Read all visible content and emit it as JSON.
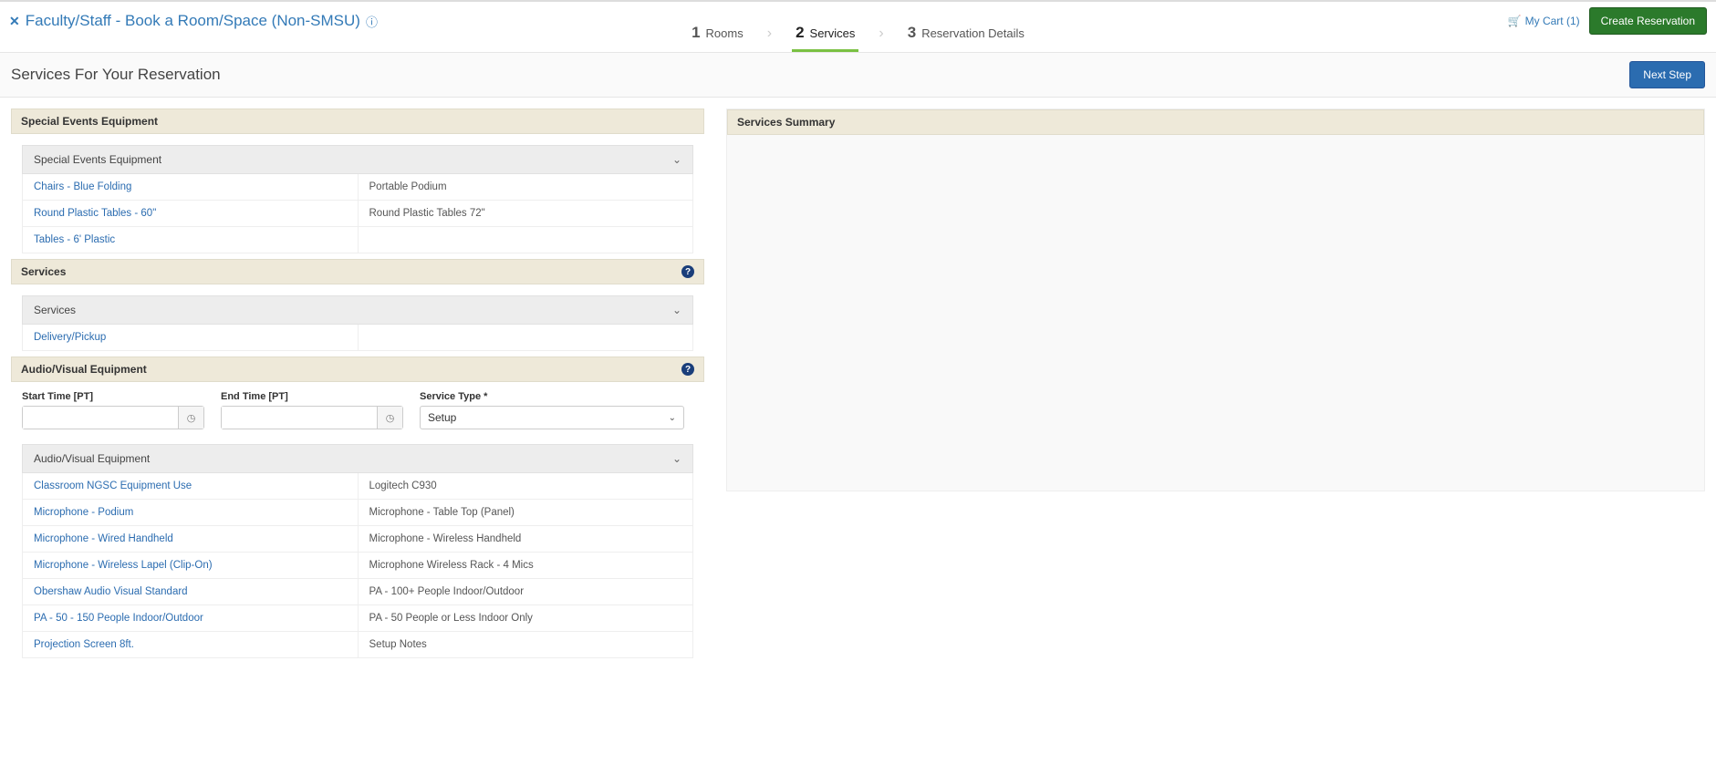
{
  "header": {
    "page_title": "Faculty/Staff - Book a Room/Space (Non-SMSU)",
    "cart_label": "My Cart (1)",
    "create_btn": "Create Reservation"
  },
  "steps": {
    "s1_num": "1",
    "s1_label": "Rooms",
    "s2_num": "2",
    "s2_label": "Services",
    "s3_num": "3",
    "s3_label": "Reservation Details"
  },
  "subheader": {
    "title": "Services For Your Reservation",
    "next_btn": "Next Step"
  },
  "sections": {
    "special_header": "Special Events Equipment",
    "special_sub": "Special Events Equipment",
    "services_header": "Services",
    "services_sub": "Services",
    "av_header": "Audio/Visual Equipment",
    "av_sub": "Audio/Visual Equipment",
    "summary_header": "Services Summary"
  },
  "special_items": {
    "r0c0": "Chairs - Blue Folding",
    "r0c1": "Portable Podium",
    "r1c0": "Round Plastic Tables - 60\"",
    "r1c1": "Round Plastic Tables 72\"",
    "r2c0": "Tables - 6' Plastic",
    "r2c1": ""
  },
  "services_items": {
    "r0c0": "Delivery/Pickup",
    "r0c1": ""
  },
  "av_form": {
    "start_label": "Start Time [PT]",
    "end_label": "End Time [PT]",
    "type_label": "Service Type *",
    "type_value": "Setup"
  },
  "av_items": {
    "r0c0": "Classroom NGSC Equipment Use",
    "r0c1": "Logitech C930",
    "r1c0": "Microphone - Podium",
    "r1c1": "Microphone - Table Top (Panel)",
    "r2c0": "Microphone - Wired Handheld",
    "r2c1": "Microphone - Wireless Handheld",
    "r3c0": "Microphone - Wireless Lapel (Clip-On)",
    "r3c1": "Microphone Wireless Rack - 4 Mics",
    "r4c0": "Obershaw Audio Visual Standard",
    "r4c1": "PA - 100+ People Indoor/Outdoor",
    "r5c0": "PA - 50 - 150 People Indoor/Outdoor",
    "r5c1": "PA - 50 People or Less Indoor Only",
    "r6c0": "Projection Screen 8ft.",
    "r6c1": "Setup Notes"
  }
}
